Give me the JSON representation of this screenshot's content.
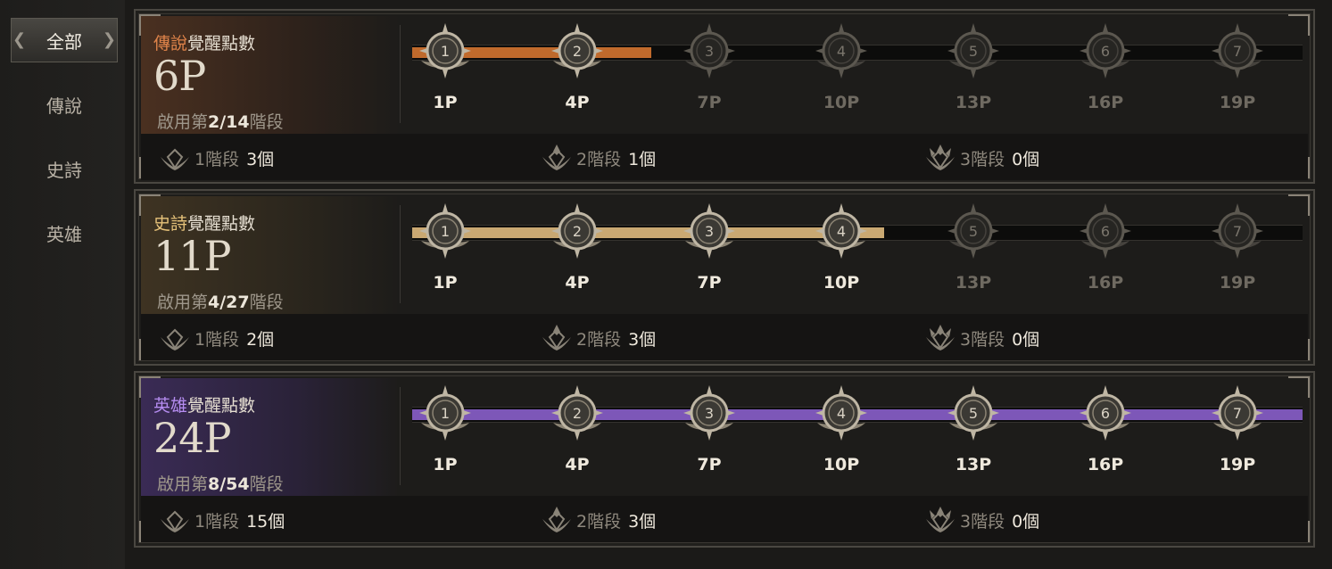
{
  "sidebar": {
    "tabs": [
      {
        "label": "全部",
        "active": true
      },
      {
        "label": "傳說",
        "active": false
      },
      {
        "label": "史詩",
        "active": false
      },
      {
        "label": "英雄",
        "active": false
      }
    ]
  },
  "progress_labels": [
    "1P",
    "4P",
    "7P",
    "10P",
    "13P",
    "16P",
    "19P"
  ],
  "node_numbers": [
    "1",
    "2",
    "3",
    "4",
    "5",
    "6",
    "7"
  ],
  "stage_labels": [
    "1階段",
    "2階段",
    "3階段"
  ],
  "panels": [
    {
      "grade": "傳說",
      "grade_color": "#e0844a",
      "title_rest": "覺醒點數",
      "points": "6P",
      "enabled_prefix": "啟用第",
      "enabled_value": "2/14",
      "enabled_suffix": "階段",
      "bar_color": "#c06a2c",
      "bar_fill_fraction": 0.269,
      "active_nodes": 2,
      "stage_counts": [
        "3個",
        "1個",
        "0個"
      ]
    },
    {
      "grade": "史詩",
      "grade_color": "#e6c27a",
      "title_rest": "覺醒點數",
      "points": "11P",
      "enabled_prefix": "啟用第",
      "enabled_value": "4/27",
      "enabled_suffix": "階段",
      "bar_color": "#c9a872",
      "bar_fill_fraction": 0.53,
      "active_nodes": 4,
      "stage_counts": [
        "2個",
        "3個",
        "0個"
      ]
    },
    {
      "grade": "英雄",
      "grade_color": "#b58cf0",
      "title_rest": "覺醒點數",
      "points": "24P",
      "enabled_prefix": "啟用第",
      "enabled_value": "8/54",
      "enabled_suffix": "階段",
      "bar_color": "#7d57b8",
      "bar_fill_fraction": 1.0,
      "active_nodes": 7,
      "stage_counts": [
        "15個",
        "3個",
        "0個"
      ]
    }
  ]
}
